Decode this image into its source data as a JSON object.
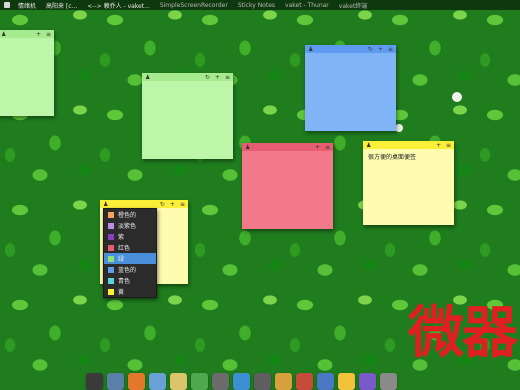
{
  "taskbar": {
    "tasks": [
      {
        "label": "情绪机"
      },
      {
        "label": "高阳来 [c..."
      },
      {
        "label": "<--> 赖乔人 - vaket..."
      },
      {
        "label": "SimpleScreenRecorder"
      },
      {
        "label": "Sticky Notes"
      },
      {
        "label": "vaket - Thunar"
      },
      {
        "label": "vaket终端"
      }
    ]
  },
  "notes": {
    "green1": {
      "color": "#bdf5a9",
      "text": ""
    },
    "green2": {
      "color": "#bdf5a9",
      "text": ""
    },
    "blue": {
      "color": "#7fb5f7",
      "text": ""
    },
    "red": {
      "color": "#f2798a",
      "text": ""
    },
    "yellow1": {
      "color": "#fffcb0",
      "text": "很方便的桌面便签"
    },
    "yellow2": {
      "color": "#fffcb0",
      "text": ""
    }
  },
  "note_bar": {
    "left_glyph": "♟",
    "middle_glyph": "↻",
    "add_glyph": "+",
    "menu_glyph": "≡"
  },
  "color_menu": {
    "items": [
      {
        "label": "橙色的",
        "color": "#f7a35c"
      },
      {
        "label": "淡紫色",
        "color": "#b98ee6"
      },
      {
        "label": "紫",
        "color": "#8a3fbf"
      },
      {
        "label": "红色",
        "color": "#e85c71"
      },
      {
        "label": "绿",
        "color": "#8fe27a"
      },
      {
        "label": "蓝色的",
        "color": "#5e9cf2"
      },
      {
        "label": "青色",
        "color": "#56d6d6"
      },
      {
        "label": "黄",
        "color": "#fbef3a"
      }
    ],
    "active_index": 4
  },
  "watermark": {
    "text": "微器"
  },
  "dock": {
    "icons": [
      {
        "name": "terminal-icon",
        "color": "#3a3a3a"
      },
      {
        "name": "monitor-icon",
        "color": "#5a7fa8"
      },
      {
        "name": "browser-icon",
        "color": "#e3782c"
      },
      {
        "name": "files-icon",
        "color": "#6aa0d8"
      },
      {
        "name": "folder-icon",
        "color": "#dcc46a"
      },
      {
        "name": "text-editor-icon",
        "color": "#4fa84f"
      },
      {
        "name": "settings-icon",
        "color": "#6b6b6b"
      },
      {
        "name": "refresh-icon",
        "color": "#3c8fd0"
      },
      {
        "name": "media-icon",
        "color": "#5e5e5e"
      },
      {
        "name": "image-viewer-icon",
        "color": "#d8a03c"
      },
      {
        "name": "rocket-icon",
        "color": "#c84a3a"
      },
      {
        "name": "bluetooth-icon",
        "color": "#4a78c4"
      },
      {
        "name": "sun-icon",
        "color": "#f2c23a"
      },
      {
        "name": "music-icon",
        "color": "#7a5ac8"
      },
      {
        "name": "trash-icon",
        "color": "#8a8a8a"
      }
    ]
  }
}
